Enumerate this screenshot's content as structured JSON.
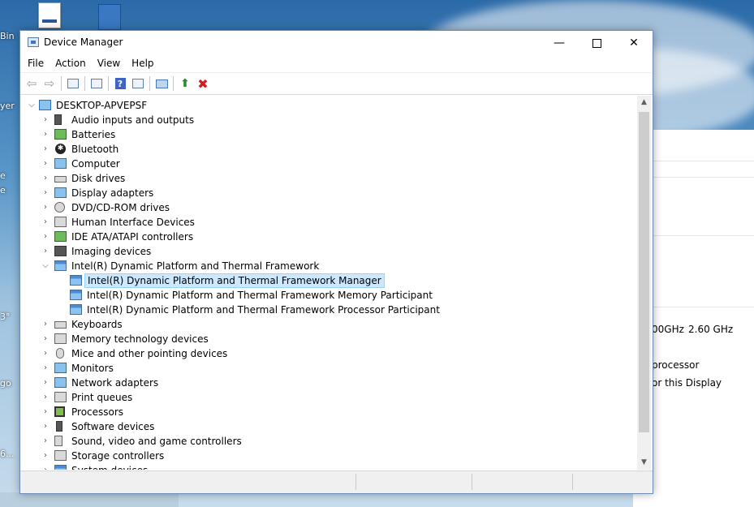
{
  "window": {
    "title": "Device Manager",
    "controls": {
      "minimize": "—",
      "maximize": "",
      "close": "✕"
    }
  },
  "menu": [
    "File",
    "Action",
    "View",
    "Help"
  ],
  "toolbar": [
    {
      "icon": "back-arrow-icon",
      "glyph": "⇦"
    },
    {
      "icon": "forward-arrow-icon",
      "glyph": "⇨"
    },
    {
      "icon": "properties-icon"
    },
    {
      "icon": "show-hidden-icon"
    },
    {
      "icon": "help-icon",
      "glyph": "?"
    },
    {
      "icon": "action-pane-icon"
    },
    {
      "icon": "scan-hardware-icon"
    },
    {
      "icon": "update-driver-icon",
      "glyph": "⬆"
    },
    {
      "icon": "uninstall-device-icon",
      "glyph": "✖"
    }
  ],
  "tree": {
    "root": "DESKTOP-APVEPSF",
    "categories": [
      {
        "label": "Audio inputs and outputs",
        "icon": "speaker-icon"
      },
      {
        "label": "Batteries",
        "icon": "battery-icon"
      },
      {
        "label": "Bluetooth",
        "icon": "bluetooth-icon"
      },
      {
        "label": "Computer",
        "icon": "computer-icon"
      },
      {
        "label": "Disk drives",
        "icon": "disk-drive-icon"
      },
      {
        "label": "Display adapters",
        "icon": "display-adapter-icon"
      },
      {
        "label": "DVD/CD-ROM drives",
        "icon": "dvd-drive-icon"
      },
      {
        "label": "Human Interface Devices",
        "icon": "hid-icon"
      },
      {
        "label": "IDE ATA/ATAPI controllers",
        "icon": "ide-controller-icon"
      },
      {
        "label": "Imaging devices",
        "icon": "camera-icon"
      },
      {
        "label": "Intel(R) Dynamic Platform and Thermal Framework",
        "icon": "intel-dptf-folder-icon",
        "expanded": true,
        "children": [
          {
            "label": "Intel(R) Dynamic Platform and Thermal Framework Manager",
            "selected": true
          },
          {
            "label": "Intel(R) Dynamic Platform and Thermal Framework Memory Participant"
          },
          {
            "label": "Intel(R) Dynamic Platform and Thermal Framework Processor Participant"
          }
        ]
      },
      {
        "label": "Keyboards",
        "icon": "keyboard-icon"
      },
      {
        "label": "Memory technology devices",
        "icon": "memory-device-icon"
      },
      {
        "label": "Mice and other pointing devices",
        "icon": "mouse-icon"
      },
      {
        "label": "Monitors",
        "icon": "monitor-icon"
      },
      {
        "label": "Network adapters",
        "icon": "network-adapter-icon"
      },
      {
        "label": "Print queues",
        "icon": "printer-icon"
      },
      {
        "label": "Processors",
        "icon": "processor-icon"
      },
      {
        "label": "Software devices",
        "icon": "software-device-icon"
      },
      {
        "label": "Sound, video and game controllers",
        "icon": "sound-controller-icon"
      },
      {
        "label": "Storage controllers",
        "icon": "storage-controller-icon"
      },
      {
        "label": "System devices",
        "icon": "system-device-icon"
      }
    ]
  },
  "background_window": {
    "speed_text": "00GHz",
    "speed_value": "2.60 GHz",
    "processor_text": "processor",
    "display_text": "or this Display"
  },
  "desktop_fragments": [
    "Bin",
    "yer",
    "e",
    "e",
    "3°",
    "go",
    "6..."
  ]
}
